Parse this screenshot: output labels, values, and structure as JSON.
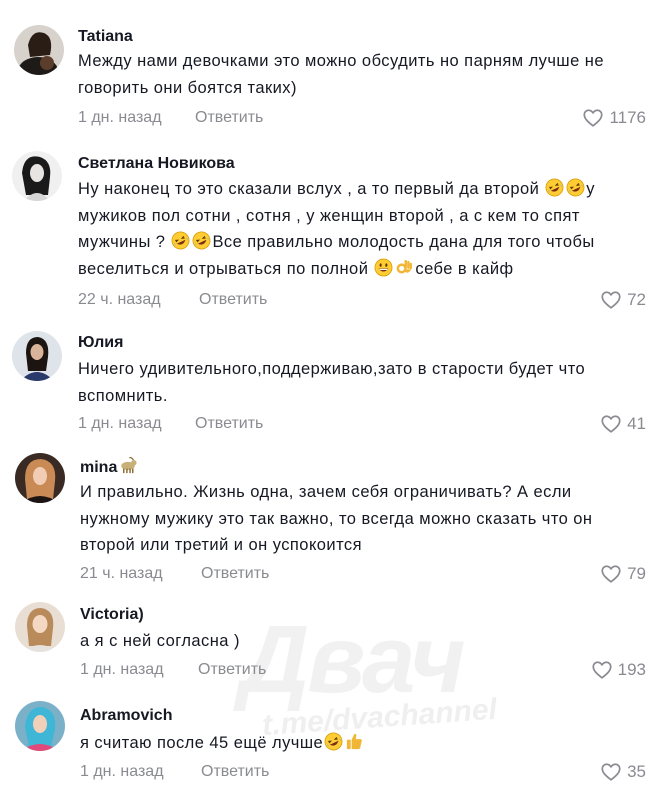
{
  "labels": {
    "reply": "Ответить"
  },
  "comments": [
    {
      "username": "Tatiana",
      "lines": [
        "Между нами девочками это можно обсудить но парням лучше не",
        "говорить они боятся таких)"
      ],
      "time": "1 дн. назад",
      "likes": "1176"
    },
    {
      "username": "Светлана Новикова",
      "line1": "Ну наконец то это сказали вслух , а то первый да второй",
      "line1_tail": "у",
      "line2": "мужиков пол сотни , сотня , у женщин второй , а с кем то спят",
      "line3a": "мужчины ?",
      "line3b": "Все правильно молодость дана для того чтобы",
      "line4a": "веселиться и отрываться по полной",
      "line4b": "себе в кайф",
      "time": "22 ч. назад",
      "likes": "72"
    },
    {
      "username": "Юлия",
      "lines": [
        "Ничего удивительного,поддерживаю,зато в старости будет что",
        "вспомнить."
      ],
      "time": "1 дн. назад",
      "likes": "41"
    },
    {
      "username": "mina",
      "lines": [
        "И правильно. Жизнь одна, зачем себя ограничивать? А если",
        "нужному мужику это так важно, то всегда можно сказать что он",
        "второй или третий и он успокоится"
      ],
      "time": "21 ч. назад",
      "likes": "79"
    },
    {
      "username": "Victoria)",
      "lines": [
        "а я с ней согласна )"
      ],
      "time": "1 дн. назад",
      "likes": "193"
    },
    {
      "username": "Abramovich",
      "text": "я считаю после 45 ещё лучше",
      "time": "1 дн. назад",
      "likes": "35"
    }
  ],
  "watermark": {
    "big": "Двач",
    "small": "t.me/dvachannel"
  },
  "icons": {
    "heart": "heart-outline-icon",
    "laugh": "rolling-laughing-emoji",
    "grin": "grinning-emoji",
    "ok": "ok-hand-emoji",
    "thumbs": "thumbs-up-emoji",
    "goat": "goat-emoji"
  }
}
